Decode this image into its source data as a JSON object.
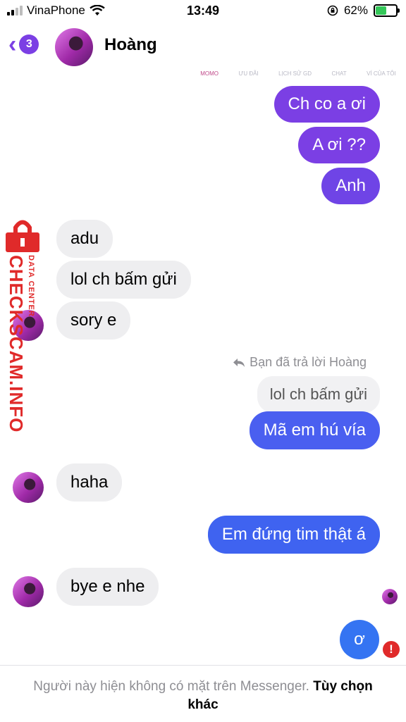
{
  "status_bar": {
    "carrier": "VinaPhone",
    "time": "13:49",
    "battery": "62%",
    "battery_level": 0.62
  },
  "header": {
    "unread_count": "3",
    "contact_name": "Hoàng"
  },
  "background_tabs": [
    "MOMO",
    "ƯU ĐÃI",
    "LỊCH SỬ GD",
    "CHAT",
    "VÍ CỦA TÔI"
  ],
  "messages": {
    "m1": "Ch co a ơi",
    "m2": "A ơi ??",
    "m3": "Anh",
    "m4": "adu",
    "m5": "lol ch bấm gửi",
    "m6": "sory e",
    "reply_note": "Bạn đã trả lời Hoàng",
    "reply_quote": "lol ch bấm gửi",
    "m7": "Mã em hú vía",
    "m8": "haha",
    "m9": "Em đứng tim thật á",
    "m10": "bye e nhe",
    "m11": "ơ"
  },
  "watermark": {
    "main": "CHECKSCAM.INFO",
    "sub": "DATA CENTER"
  },
  "footer": {
    "notice": "Người này hiện không có mặt trên Messenger.",
    "action": "Tùy chọn khác"
  },
  "colors": {
    "accent": "#7b3fe4",
    "bubble_purple": "#7b3fe4",
    "bubble_blue": "#3f63f0",
    "incoming": "#eeeef0",
    "watermark": "#e02a2a"
  }
}
